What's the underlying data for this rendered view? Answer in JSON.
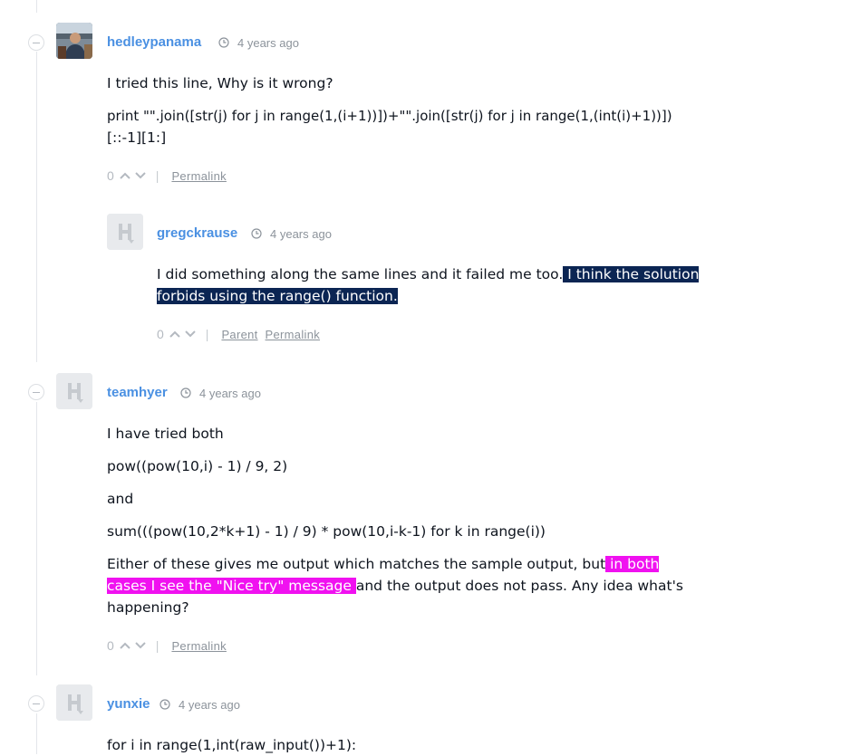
{
  "comments": [
    {
      "username": "hedleypanama",
      "time": "4 years ago",
      "paragraphs": [
        "I tried this line, Why is it wrong?",
        "print \"\".join([str(j) for j in range(1,(i+1))])+\"\".join([str(j) for j in range(1,(int(i)+1))])",
        "[::-1][1:]"
      ],
      "votes": "0",
      "links": [
        "Permalink"
      ]
    },
    {
      "username": "gregckrause",
      "time": "4 years ago",
      "text_before": "I did something along the same lines and it failed me too.",
      "text_highlight_1": " I think the solution ",
      "text_highlight_2": "forbids using the range() function.",
      "votes": "0",
      "links": [
        "Parent",
        "Permalink"
      ]
    },
    {
      "username": "teamhyer",
      "time": "4 years ago",
      "paragraphs": [
        "I have tried both",
        "pow((pow(10,i) - 1) / 9, 2)",
        "and",
        "sum(((pow(10,2*k+1) - 1) / 9) * pow(10,i-k-1) for k in range(i))"
      ],
      "last_before": "Either of these gives me output which matches the sample output, but",
      "last_highlight_1": " in both ",
      "last_highlight_2": "cases I see the \"Nice try\" message ",
      "last_after": "and the output does not pass. Any idea what's",
      "last_line3": "happening?",
      "votes": "0",
      "links": [
        "Permalink"
      ]
    },
    {
      "username": "yunxie",
      "time": "4 years ago",
      "paragraphs": [
        "for i in range(1,int(raw_input())+1):"
      ]
    }
  ],
  "colors": {
    "username": "#4a90e2",
    "highlight_navy": "#0b2553",
    "highlight_pink": "#f011f0"
  }
}
